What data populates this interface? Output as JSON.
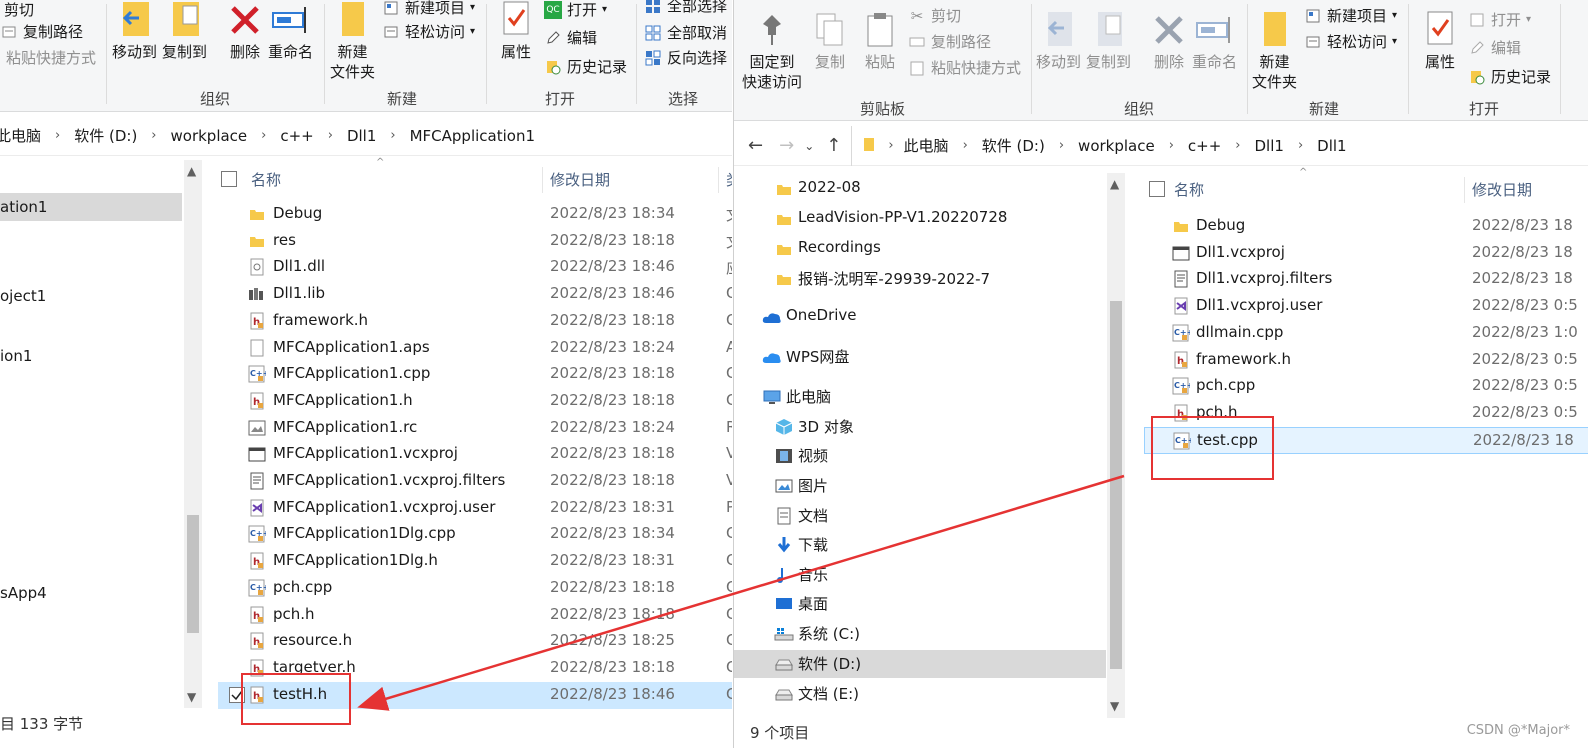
{
  "left": {
    "clipboard": {
      "cut": "剪切",
      "copy_path": "复制路径",
      "paste_shortcut": "粘贴快捷方式"
    },
    "organize": {
      "move_to": "移动到",
      "copy_to": "复制到",
      "delete": "删除",
      "rename": "重命名",
      "label": "组织"
    },
    "new_group": {
      "new_folder": "新建\n文件夹",
      "new_item": "新建项目",
      "easy_access": "轻松访问",
      "label": "新建"
    },
    "open_group": {
      "properties": "属性",
      "open": "打开",
      "edit": "编辑",
      "history": "历史记录",
      "label": "打开"
    },
    "select_group": {
      "select_all": "全部选择",
      "select_none": "全部取消",
      "invert": "反向选择",
      "label": "选择"
    },
    "breadcrumb": [
      "此电脑",
      "软件 (D:)",
      "workplace",
      "c++",
      "Dll1",
      "MFCApplication1"
    ],
    "nav_items": [
      "ation1",
      "oject1",
      "ion1",
      "sApp4"
    ],
    "columns": {
      "name": "名称",
      "date": "修改日期",
      "type": "类"
    },
    "files": [
      {
        "name": "Debug",
        "date": "2022/8/23 18:34",
        "type": "文",
        "icon": "folder-icon"
      },
      {
        "name": "res",
        "date": "2022/8/23 18:18",
        "type": "文",
        "icon": "folder-icon"
      },
      {
        "name": "Dll1.dll",
        "date": "2022/8/23 18:46",
        "type": "应",
        "icon": "dll-file-icon"
      },
      {
        "name": "Dll1.lib",
        "date": "2022/8/23 18:46",
        "type": "O",
        "icon": "lib-file-icon"
      },
      {
        "name": "framework.h",
        "date": "2022/8/23 18:18",
        "type": "C",
        "icon": "header-file-icon"
      },
      {
        "name": "MFCApplication1.aps",
        "date": "2022/8/23 18:24",
        "type": "A",
        "icon": "generic-file-icon"
      },
      {
        "name": "MFCApplication1.cpp",
        "date": "2022/8/23 18:18",
        "type": "C",
        "icon": "cpp-file-icon"
      },
      {
        "name": "MFCApplication1.h",
        "date": "2022/8/23 18:18",
        "type": "C",
        "icon": "header-file-icon"
      },
      {
        "name": "MFCApplication1.rc",
        "date": "2022/8/23 18:24",
        "type": "R",
        "icon": "rc-file-icon"
      },
      {
        "name": "MFCApplication1.vcxproj",
        "date": "2022/8/23 18:18",
        "type": "V",
        "icon": "vcxproj-file-icon"
      },
      {
        "name": "MFCApplication1.vcxproj.filters",
        "date": "2022/8/23 18:18",
        "type": "V",
        "icon": "filters-file-icon"
      },
      {
        "name": "MFCApplication1.vcxproj.user",
        "date": "2022/8/23 18:31",
        "type": "P",
        "icon": "vs-user-file-icon"
      },
      {
        "name": "MFCApplication1Dlg.cpp",
        "date": "2022/8/23 18:34",
        "type": "C",
        "icon": "cpp-file-icon"
      },
      {
        "name": "MFCApplication1Dlg.h",
        "date": "2022/8/23 18:31",
        "type": "C",
        "icon": "header-file-icon"
      },
      {
        "name": "pch.cpp",
        "date": "2022/8/23 18:18",
        "type": "C",
        "icon": "cpp-file-icon"
      },
      {
        "name": "pch.h",
        "date": "2022/8/23 18:18",
        "type": "C",
        "icon": "header-file-icon"
      },
      {
        "name": "resource.h",
        "date": "2022/8/23 18:25",
        "type": "C",
        "icon": "header-file-icon"
      },
      {
        "name": "targetver.h",
        "date": "2022/8/23 18:18",
        "type": "C",
        "icon": "header-file-icon"
      },
      {
        "name": "testH.h",
        "date": "2022/8/23 18:46",
        "type": "C",
        "icon": "header-file-icon"
      }
    ],
    "status": "目 133 字节"
  },
  "right": {
    "clipboard": {
      "pin": "固定到\n快速访问",
      "copy": "复制",
      "paste": "粘贴",
      "cut": "剪切",
      "copy_path": "复制路径",
      "paste_shortcut": "粘贴快捷方式",
      "label": "剪贴板"
    },
    "organize": {
      "move_to": "移动到",
      "copy_to": "复制到",
      "delete": "删除",
      "rename": "重命名",
      "label": "组织"
    },
    "new_group": {
      "new_folder": "新建\n文件夹",
      "new_item": "新建项目",
      "easy_access": "轻松访问",
      "label": "新建"
    },
    "open_group": {
      "properties": "属性",
      "open": "打开",
      "edit": "编辑",
      "history": "历史记录",
      "label": "打开"
    },
    "breadcrumb": [
      "此电脑",
      "软件 (D:)",
      "workplace",
      "c++",
      "Dll1",
      "Dll1"
    ],
    "nav_items": [
      {
        "label": "2022-08",
        "icon": "folder-icon"
      },
      {
        "label": "LeadVision-PP-V1.20220728",
        "icon": "folder-icon"
      },
      {
        "label": "Recordings",
        "icon": "folder-icon"
      },
      {
        "label": "报销-沈明军-29939-2022-7",
        "icon": "folder-icon"
      },
      {
        "label": "OneDrive",
        "icon": "onedrive-icon"
      },
      {
        "label": "WPS网盘",
        "icon": "wps-cloud-icon"
      },
      {
        "label": "此电脑",
        "icon": "this-pc-icon"
      },
      {
        "label": "3D 对象",
        "icon": "3d-objects-icon"
      },
      {
        "label": "视频",
        "icon": "videos-icon"
      },
      {
        "label": "图片",
        "icon": "pictures-icon"
      },
      {
        "label": "文档",
        "icon": "documents-icon"
      },
      {
        "label": "下载",
        "icon": "downloads-icon"
      },
      {
        "label": "音乐",
        "icon": "music-icon"
      },
      {
        "label": "桌面",
        "icon": "desktop-icon"
      },
      {
        "label": "系统 (C:)",
        "icon": "drive-c-icon"
      },
      {
        "label": "软件 (D:)",
        "icon": "drive-d-icon"
      },
      {
        "label": "文档 (E:)",
        "icon": "drive-e-icon"
      }
    ],
    "columns": {
      "name": "名称",
      "date": "修改日期"
    },
    "files": [
      {
        "name": "Debug",
        "date": "2022/8/23 18",
        "icon": "folder-icon"
      },
      {
        "name": "Dll1.vcxproj",
        "date": "2022/8/23 18",
        "icon": "vcxproj-file-icon"
      },
      {
        "name": "Dll1.vcxproj.filters",
        "date": "2022/8/23 18",
        "icon": "filters-file-icon"
      },
      {
        "name": "Dll1.vcxproj.user",
        "date": "2022/8/23 0:5",
        "icon": "vs-user-file-icon"
      },
      {
        "name": "dllmain.cpp",
        "date": "2022/8/23 1:0",
        "icon": "cpp-file-icon"
      },
      {
        "name": "framework.h",
        "date": "2022/8/23 0:5",
        "icon": "header-file-icon"
      },
      {
        "name": "pch.cpp",
        "date": "2022/8/23 0:5",
        "icon": "cpp-file-icon"
      },
      {
        "name": "pch.h",
        "date": "2022/8/23 0:5",
        "icon": "header-file-icon"
      },
      {
        "name": "test.cpp",
        "date": "2022/8/23 18",
        "icon": "cpp-file-icon"
      }
    ],
    "status": "9 个项目"
  },
  "watermark": "CSDN @*Major*",
  "colors": {
    "annotation_red": "#e53333",
    "selection": "#cce8ff",
    "folder": "#f6c94a",
    "header_red": "#b0282f",
    "cpp_blue": "#4a7cc4"
  }
}
